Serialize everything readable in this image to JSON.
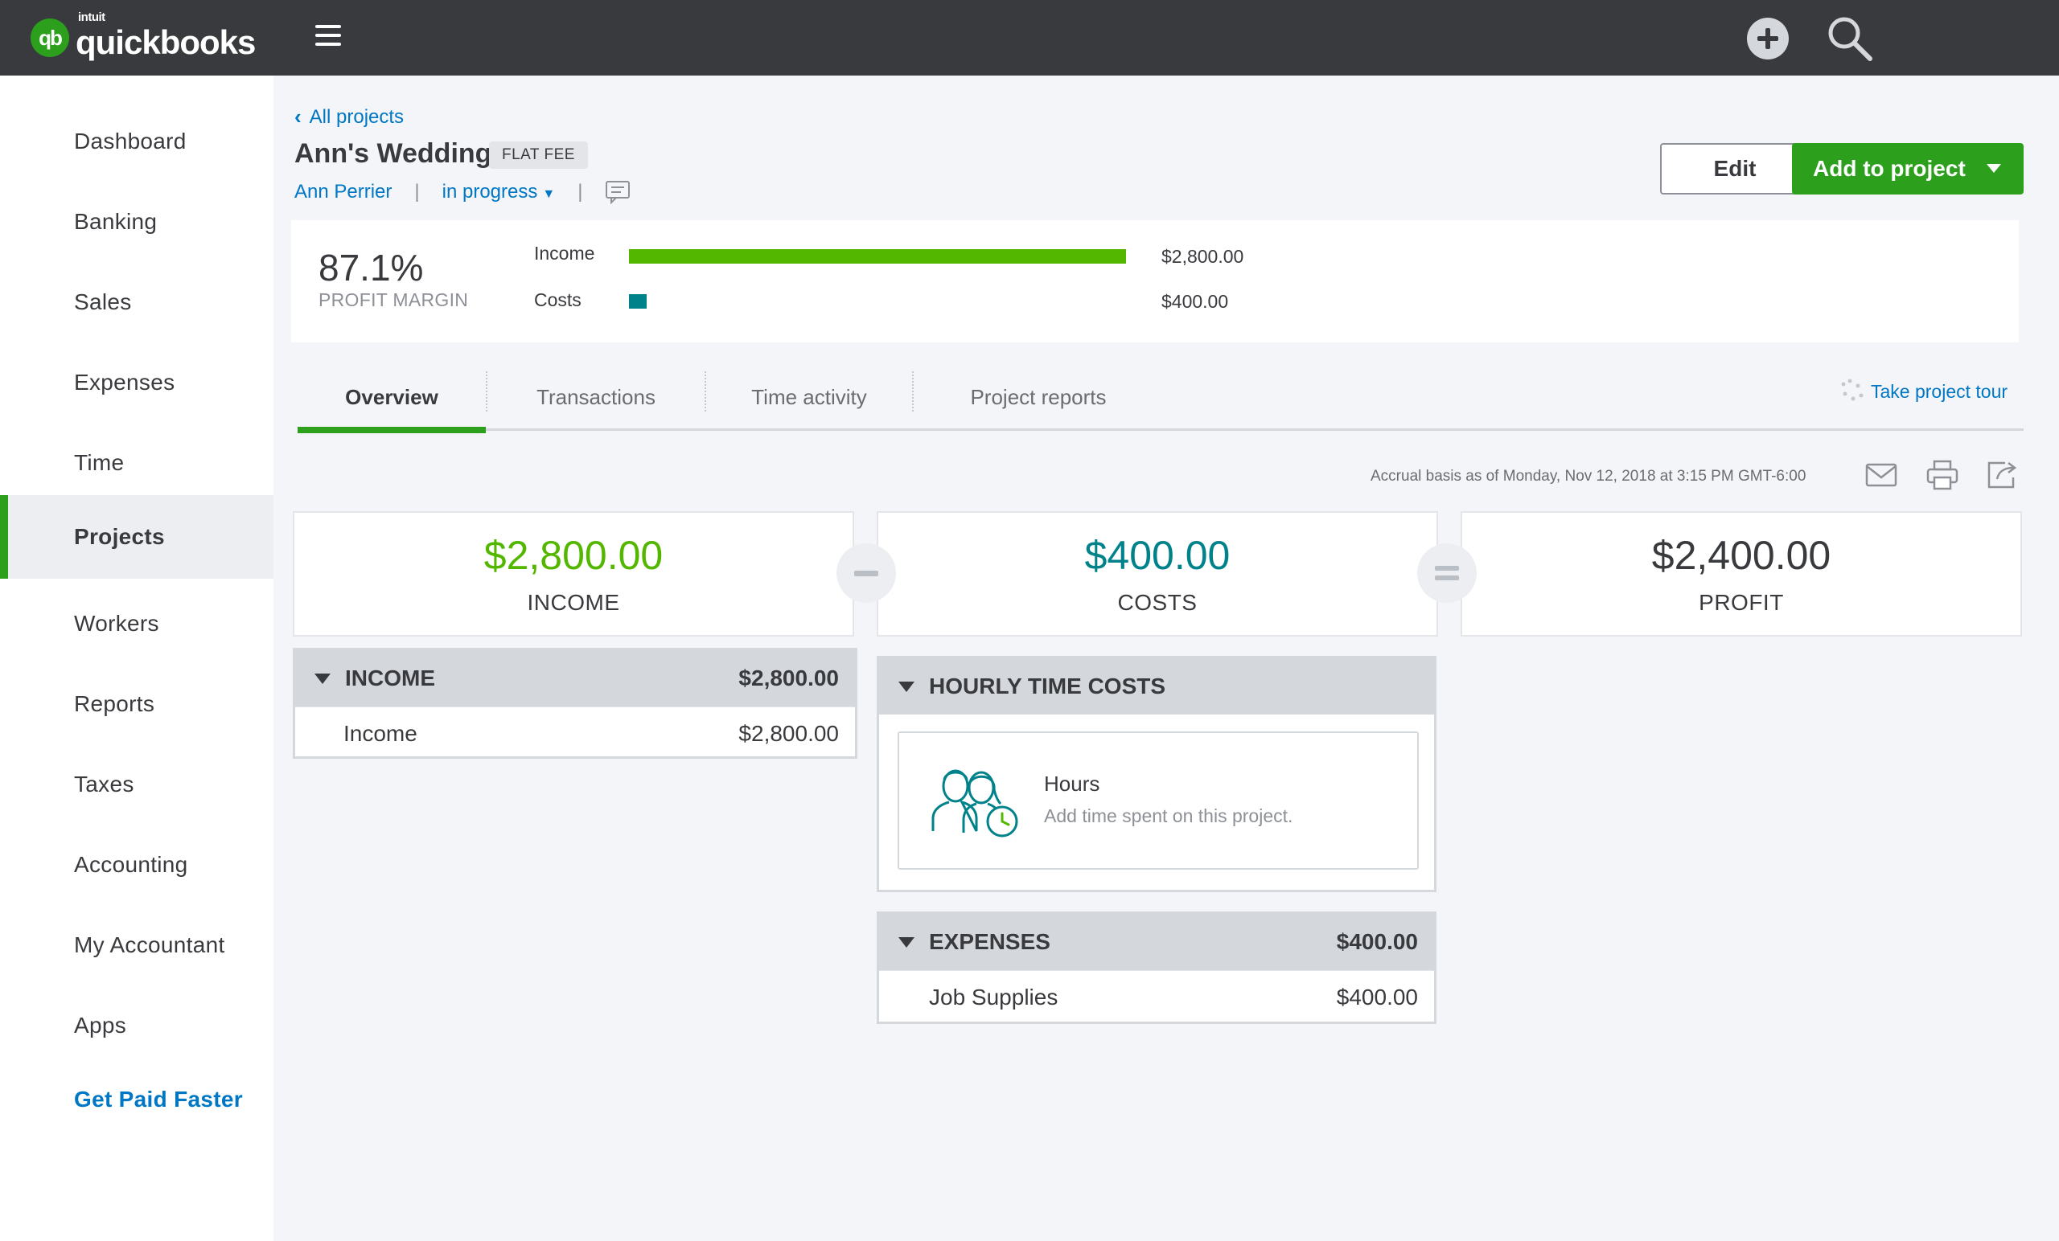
{
  "brand": {
    "badge": "qb",
    "intuit": "intuit",
    "name": "quickbooks"
  },
  "sidebar": {
    "items": [
      {
        "label": "Dashboard"
      },
      {
        "label": "Banking"
      },
      {
        "label": "Sales"
      },
      {
        "label": "Expenses"
      },
      {
        "label": "Time"
      },
      {
        "label": "Projects",
        "active": true
      },
      {
        "label": "Workers"
      },
      {
        "label": "Reports"
      },
      {
        "label": "Taxes"
      },
      {
        "label": "Accounting"
      },
      {
        "label": "My Accountant"
      },
      {
        "label": "Apps"
      }
    ],
    "promo": "Get Paid Faster"
  },
  "header": {
    "back_label": "All projects",
    "title": "Ann's Wedding",
    "badge": "FLAT FEE",
    "customer": "Ann Perrier",
    "status": "in progress",
    "edit_label": "Edit",
    "add_label": "Add to project"
  },
  "profit": {
    "margin": "87.1%",
    "margin_label": "PROFIT MARGIN",
    "income_label": "Income",
    "income_amount": "$2,800.00",
    "income_ratio": 1.0,
    "costs_label": "Costs",
    "costs_amount": "$400.00",
    "costs_ratio": 0.143
  },
  "tabs": [
    {
      "label": "Overview",
      "active": true
    },
    {
      "label": "Transactions"
    },
    {
      "label": "Time activity"
    },
    {
      "label": "Project reports"
    }
  ],
  "tour_label": "Take project tour",
  "basis": "Accrual basis as of Monday, Nov 12, 2018 at 3:15 PM GMT-6:00",
  "summary": {
    "income": {
      "amount": "$2,800.00",
      "label": "INCOME"
    },
    "costs": {
      "amount": "$400.00",
      "label": "COSTS"
    },
    "profit": {
      "amount": "$2,400.00",
      "label": "PROFIT"
    }
  },
  "income_section": {
    "title": "INCOME",
    "total": "$2,800.00",
    "rows": [
      {
        "name": "Income",
        "amount": "$2,800.00"
      }
    ]
  },
  "hourly_section": {
    "title": "HOURLY TIME COSTS",
    "card_title": "Hours",
    "card_sub": "Add time spent on this project."
  },
  "expenses_section": {
    "title": "EXPENSES",
    "total": "$400.00",
    "rows": [
      {
        "name": "Job Supplies",
        "amount": "$400.00"
      }
    ]
  },
  "colors": {
    "topbar": "#393a3d",
    "brand_green": "#2ca01c",
    "income_green": "#53b700",
    "costs_teal": "#00828a",
    "link_blue": "#0077c5"
  }
}
